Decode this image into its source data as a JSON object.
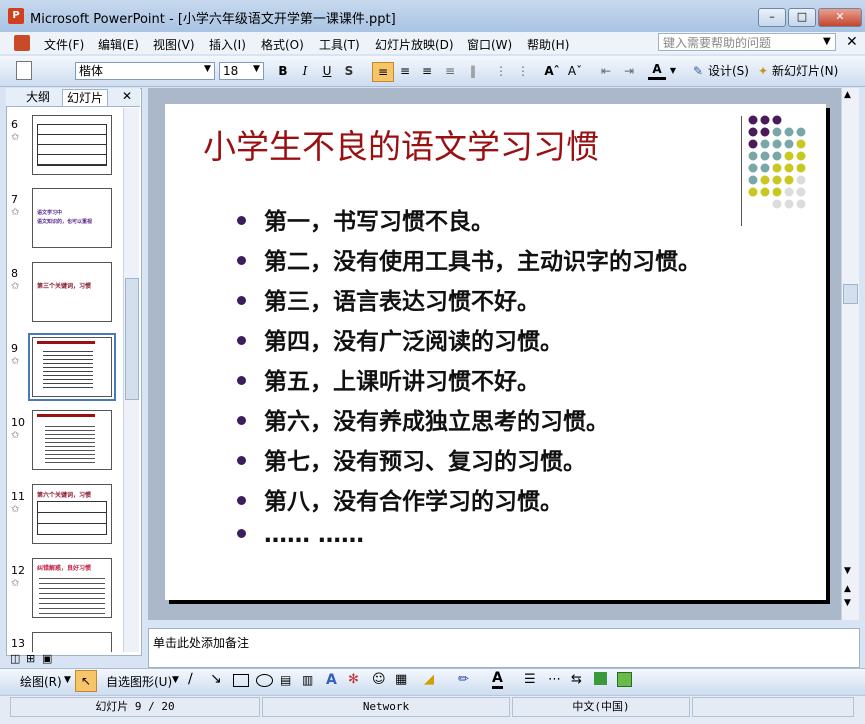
{
  "window": {
    "title": "Microsoft PowerPoint - [小学六年级语文开学第一课课件.ppt]",
    "app_icon": "powerpoint-icon"
  },
  "menu": {
    "items": [
      "文件(F)",
      "编辑(E)",
      "视图(V)",
      "插入(I)",
      "格式(O)",
      "工具(T)",
      "幻灯片放映(D)",
      "窗口(W)",
      "帮助(H)"
    ],
    "help_placeholder": "键入需要帮助的问题"
  },
  "toolbar": {
    "font": "楷体",
    "size": "18",
    "bold": "B",
    "italic": "I",
    "underline": "U",
    "shadow": "S",
    "design": "设计(S)",
    "new_slide": "新幻灯片(N)"
  },
  "left_pane": {
    "tabs": [
      "大纲",
      "幻灯片"
    ],
    "active_tab": "幻灯片",
    "slide_numbers": [
      "6",
      "7",
      "8",
      "9",
      "10",
      "11",
      "12",
      "13"
    ],
    "selected": "9",
    "thumb7_lines": [
      "语文学习中",
      "语文知识的，也可以重视"
    ],
    "thumb8_text": "第三个关键词，习惯",
    "thumb11_text": "第六个关键词，习惯",
    "thumb12_text": "纠错解惑，良好习惯"
  },
  "slide": {
    "title": "小学生不良的语文学习习惯",
    "bullets": [
      "第一，书写习惯不良。",
      "第二，没有使用工具书，主动识字的习惯。",
      "第三，语言表达习惯不好。",
      "第四，没有广泛阅读的习惯。",
      "第五，上课听讲习惯不好。",
      "第六，没有养成独立思考的习惯。",
      "第七，没有预习、复习的习惯。",
      "第八，没有合作学习的习惯。",
      "…… ……"
    ],
    "bullet_color": "#3a1f5c",
    "title_color": "#9a1010",
    "dot_colors": [
      "#4a1a5a",
      "#7aa8a8",
      "#c8c820",
      "#dcdcdc"
    ]
  },
  "notes": {
    "placeholder": "单击此处添加备注"
  },
  "drawbar": {
    "draw": "绘图(R)",
    "autoshapes": "自选图形(U)"
  },
  "status": {
    "slide": "幻灯片 9 / 20",
    "design": "Network",
    "language": "中文(中国)"
  }
}
